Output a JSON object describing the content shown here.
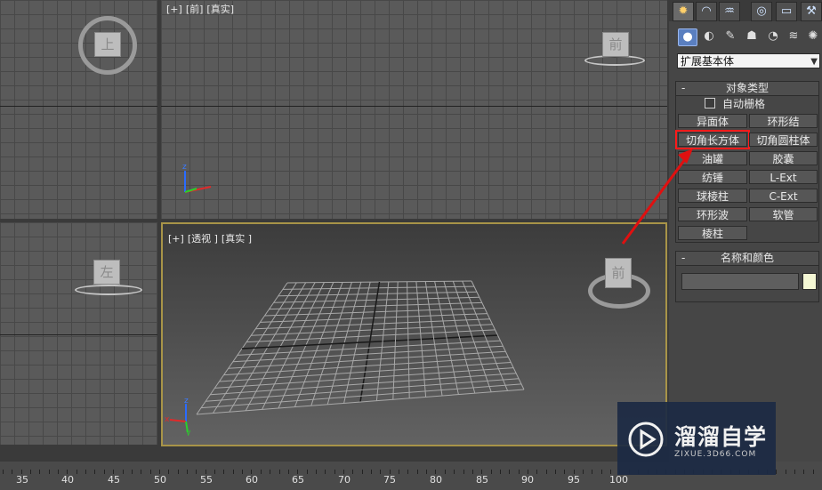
{
  "viewports": {
    "top": {
      "cube_label": "上"
    },
    "front": {
      "labels": [
        "[+]",
        "[前]",
        "[真实]"
      ],
      "cube_label": "前"
    },
    "left": {
      "cube_label": "左"
    },
    "perspective": {
      "labels": [
        "[+]",
        "[透视 ]",
        "[真实 ]"
      ],
      "cube_label": "前"
    }
  },
  "command_panel": {
    "tabs": [
      "create-tab",
      "modify-tab",
      "hierarchy-tab",
      "motion-tab",
      "display-tab",
      "utilities-tab"
    ],
    "subcategories": [
      "geometry",
      "shapes",
      "lights",
      "cameras",
      "helpers",
      "spacewarps",
      "systems"
    ],
    "dropdown": {
      "selected": "扩展基本体"
    },
    "object_type": {
      "title": "对象类型",
      "minus": "-",
      "autogrid_label": "自动栅格",
      "autogrid_checked": false,
      "buttons": [
        "异面体",
        "环形结",
        "切角长方体",
        "切角圆柱体",
        "油罐",
        "胶囊",
        "纺锤",
        "L-Ext",
        "球棱柱",
        "C-Ext",
        "环形波",
        "软管",
        "棱柱"
      ],
      "highlighted": "切角长方体"
    },
    "name_color": {
      "title": "名称和颜色",
      "minus": "-",
      "name_value": "",
      "swatch_color": "#f4f7d4"
    }
  },
  "timeline": {
    "ticks": [
      "35",
      "40",
      "45",
      "50",
      "55",
      "60",
      "65",
      "70",
      "75",
      "80",
      "85",
      "90",
      "95",
      "100"
    ]
  },
  "watermark": {
    "name": "溜溜自学",
    "url": "ZIXUE.3D66.COM"
  },
  "axis": {
    "x": "x",
    "y": "y",
    "z": "z"
  },
  "colors": {
    "highlight": "#ff1a1a",
    "active_border": "#a89448",
    "panel": "#464646"
  }
}
